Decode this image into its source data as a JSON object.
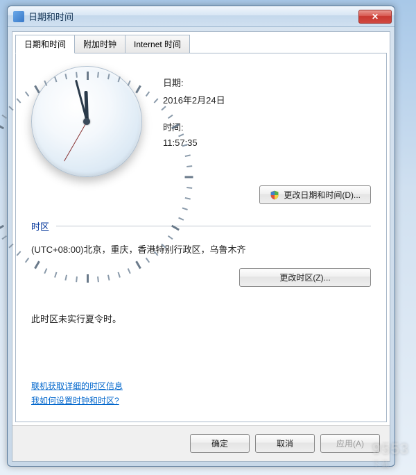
{
  "window": {
    "title": "日期和时间"
  },
  "tabs": [
    {
      "label": "日期和时间",
      "active": true
    },
    {
      "label": "附加时钟",
      "active": false
    },
    {
      "label": "Internet 时间",
      "active": false
    }
  ],
  "datetime": {
    "date_label": "日期:",
    "date_value": "2016年2月24日",
    "time_label": "时间:",
    "time_value": "11:57:35",
    "change_button": "更改日期和时间(D)..."
  },
  "timezone": {
    "header": "时区",
    "description": "(UTC+08:00)北京，重庆，香港特别行政区，乌鲁木齐",
    "change_button": "更改时区(Z)...",
    "dst_note": "此时区未实行夏令时。"
  },
  "links": {
    "more_info": "联机获取详细的时区信息",
    "how_to": "我如何设置时钟和时区?"
  },
  "footer": {
    "ok": "确定",
    "cancel": "取消",
    "apply": "应用(A)"
  },
  "watermark": {
    "main": "9553",
    "sub": "下载"
  }
}
